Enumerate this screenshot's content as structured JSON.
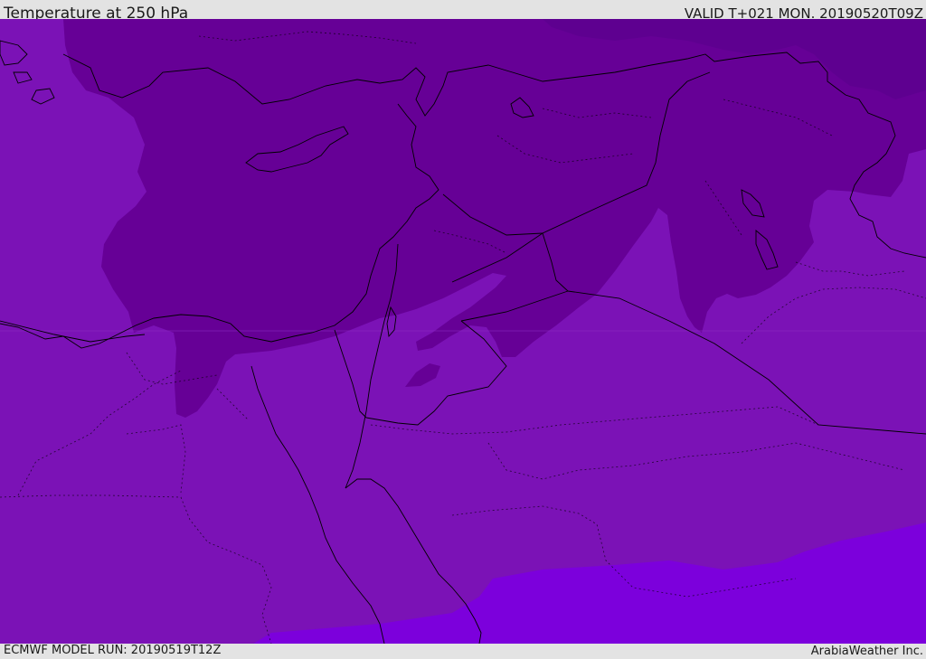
{
  "header": {
    "title": "Temperature at 250 hPa",
    "valid": "VALID T+021 MON. 20190520T09Z"
  },
  "footer": {
    "model_run": "ECMWF MODEL RUN: 20190519T12Z",
    "credit": "ArabiaWeather Inc."
  },
  "colors": {
    "band_warm": "#7b12b6",
    "band_mid": "#660096",
    "band_dark": "#5e0090",
    "band_south": "#7c00dc",
    "coastline": "#000000",
    "background_bar": "#e3e3e3"
  }
}
